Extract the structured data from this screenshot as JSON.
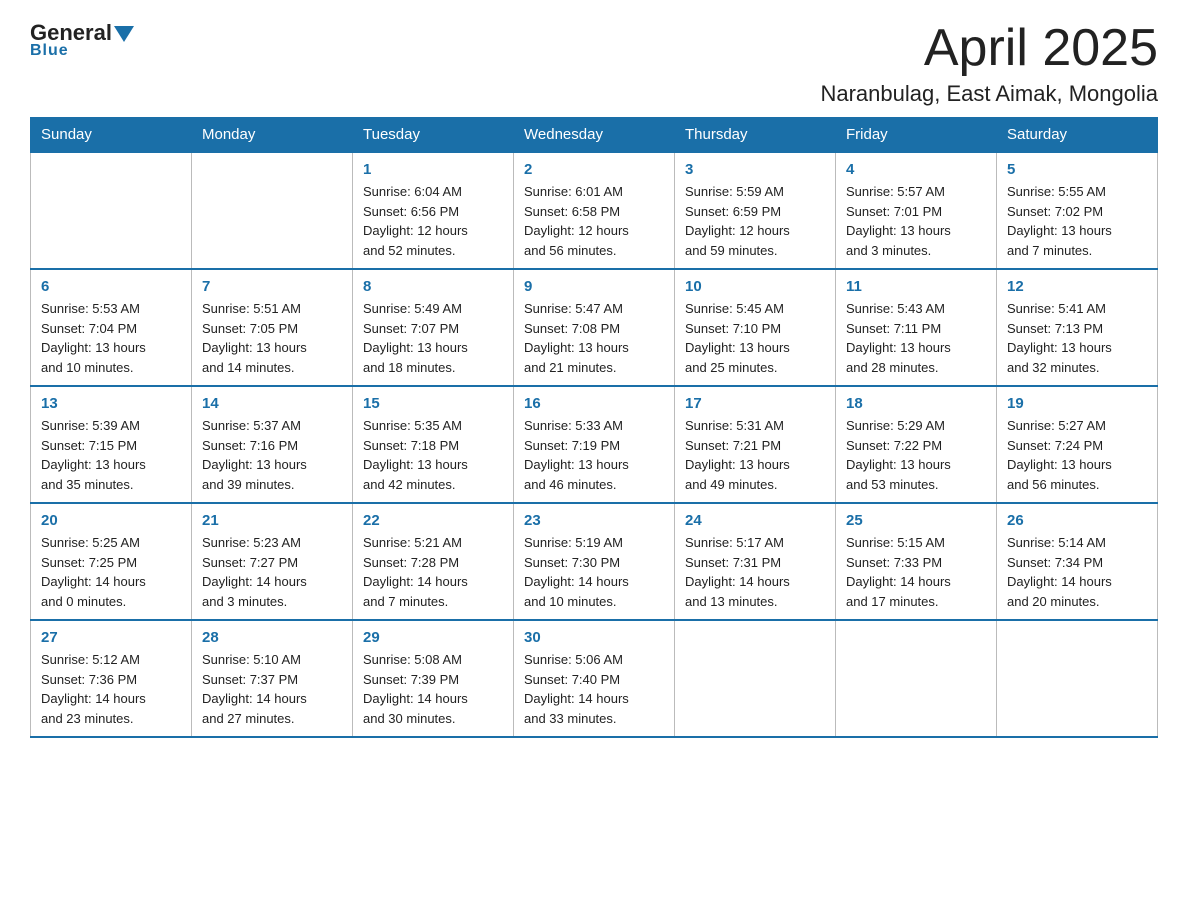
{
  "header": {
    "logo_general": "General",
    "logo_blue": "Blue",
    "month_title": "April 2025",
    "location": "Naranbulag, East Aimak, Mongolia"
  },
  "days_of_week": [
    "Sunday",
    "Monday",
    "Tuesday",
    "Wednesday",
    "Thursday",
    "Friday",
    "Saturday"
  ],
  "weeks": [
    [
      {
        "day": "",
        "info": ""
      },
      {
        "day": "",
        "info": ""
      },
      {
        "day": "1",
        "info": "Sunrise: 6:04 AM\nSunset: 6:56 PM\nDaylight: 12 hours\nand 52 minutes."
      },
      {
        "day": "2",
        "info": "Sunrise: 6:01 AM\nSunset: 6:58 PM\nDaylight: 12 hours\nand 56 minutes."
      },
      {
        "day": "3",
        "info": "Sunrise: 5:59 AM\nSunset: 6:59 PM\nDaylight: 12 hours\nand 59 minutes."
      },
      {
        "day": "4",
        "info": "Sunrise: 5:57 AM\nSunset: 7:01 PM\nDaylight: 13 hours\nand 3 minutes."
      },
      {
        "day": "5",
        "info": "Sunrise: 5:55 AM\nSunset: 7:02 PM\nDaylight: 13 hours\nand 7 minutes."
      }
    ],
    [
      {
        "day": "6",
        "info": "Sunrise: 5:53 AM\nSunset: 7:04 PM\nDaylight: 13 hours\nand 10 minutes."
      },
      {
        "day": "7",
        "info": "Sunrise: 5:51 AM\nSunset: 7:05 PM\nDaylight: 13 hours\nand 14 minutes."
      },
      {
        "day": "8",
        "info": "Sunrise: 5:49 AM\nSunset: 7:07 PM\nDaylight: 13 hours\nand 18 minutes."
      },
      {
        "day": "9",
        "info": "Sunrise: 5:47 AM\nSunset: 7:08 PM\nDaylight: 13 hours\nand 21 minutes."
      },
      {
        "day": "10",
        "info": "Sunrise: 5:45 AM\nSunset: 7:10 PM\nDaylight: 13 hours\nand 25 minutes."
      },
      {
        "day": "11",
        "info": "Sunrise: 5:43 AM\nSunset: 7:11 PM\nDaylight: 13 hours\nand 28 minutes."
      },
      {
        "day": "12",
        "info": "Sunrise: 5:41 AM\nSunset: 7:13 PM\nDaylight: 13 hours\nand 32 minutes."
      }
    ],
    [
      {
        "day": "13",
        "info": "Sunrise: 5:39 AM\nSunset: 7:15 PM\nDaylight: 13 hours\nand 35 minutes."
      },
      {
        "day": "14",
        "info": "Sunrise: 5:37 AM\nSunset: 7:16 PM\nDaylight: 13 hours\nand 39 minutes."
      },
      {
        "day": "15",
        "info": "Sunrise: 5:35 AM\nSunset: 7:18 PM\nDaylight: 13 hours\nand 42 minutes."
      },
      {
        "day": "16",
        "info": "Sunrise: 5:33 AM\nSunset: 7:19 PM\nDaylight: 13 hours\nand 46 minutes."
      },
      {
        "day": "17",
        "info": "Sunrise: 5:31 AM\nSunset: 7:21 PM\nDaylight: 13 hours\nand 49 minutes."
      },
      {
        "day": "18",
        "info": "Sunrise: 5:29 AM\nSunset: 7:22 PM\nDaylight: 13 hours\nand 53 minutes."
      },
      {
        "day": "19",
        "info": "Sunrise: 5:27 AM\nSunset: 7:24 PM\nDaylight: 13 hours\nand 56 minutes."
      }
    ],
    [
      {
        "day": "20",
        "info": "Sunrise: 5:25 AM\nSunset: 7:25 PM\nDaylight: 14 hours\nand 0 minutes."
      },
      {
        "day": "21",
        "info": "Sunrise: 5:23 AM\nSunset: 7:27 PM\nDaylight: 14 hours\nand 3 minutes."
      },
      {
        "day": "22",
        "info": "Sunrise: 5:21 AM\nSunset: 7:28 PM\nDaylight: 14 hours\nand 7 minutes."
      },
      {
        "day": "23",
        "info": "Sunrise: 5:19 AM\nSunset: 7:30 PM\nDaylight: 14 hours\nand 10 minutes."
      },
      {
        "day": "24",
        "info": "Sunrise: 5:17 AM\nSunset: 7:31 PM\nDaylight: 14 hours\nand 13 minutes."
      },
      {
        "day": "25",
        "info": "Sunrise: 5:15 AM\nSunset: 7:33 PM\nDaylight: 14 hours\nand 17 minutes."
      },
      {
        "day": "26",
        "info": "Sunrise: 5:14 AM\nSunset: 7:34 PM\nDaylight: 14 hours\nand 20 minutes."
      }
    ],
    [
      {
        "day": "27",
        "info": "Sunrise: 5:12 AM\nSunset: 7:36 PM\nDaylight: 14 hours\nand 23 minutes."
      },
      {
        "day": "28",
        "info": "Sunrise: 5:10 AM\nSunset: 7:37 PM\nDaylight: 14 hours\nand 27 minutes."
      },
      {
        "day": "29",
        "info": "Sunrise: 5:08 AM\nSunset: 7:39 PM\nDaylight: 14 hours\nand 30 minutes."
      },
      {
        "day": "30",
        "info": "Sunrise: 5:06 AM\nSunset: 7:40 PM\nDaylight: 14 hours\nand 33 minutes."
      },
      {
        "day": "",
        "info": ""
      },
      {
        "day": "",
        "info": ""
      },
      {
        "day": "",
        "info": ""
      }
    ]
  ]
}
